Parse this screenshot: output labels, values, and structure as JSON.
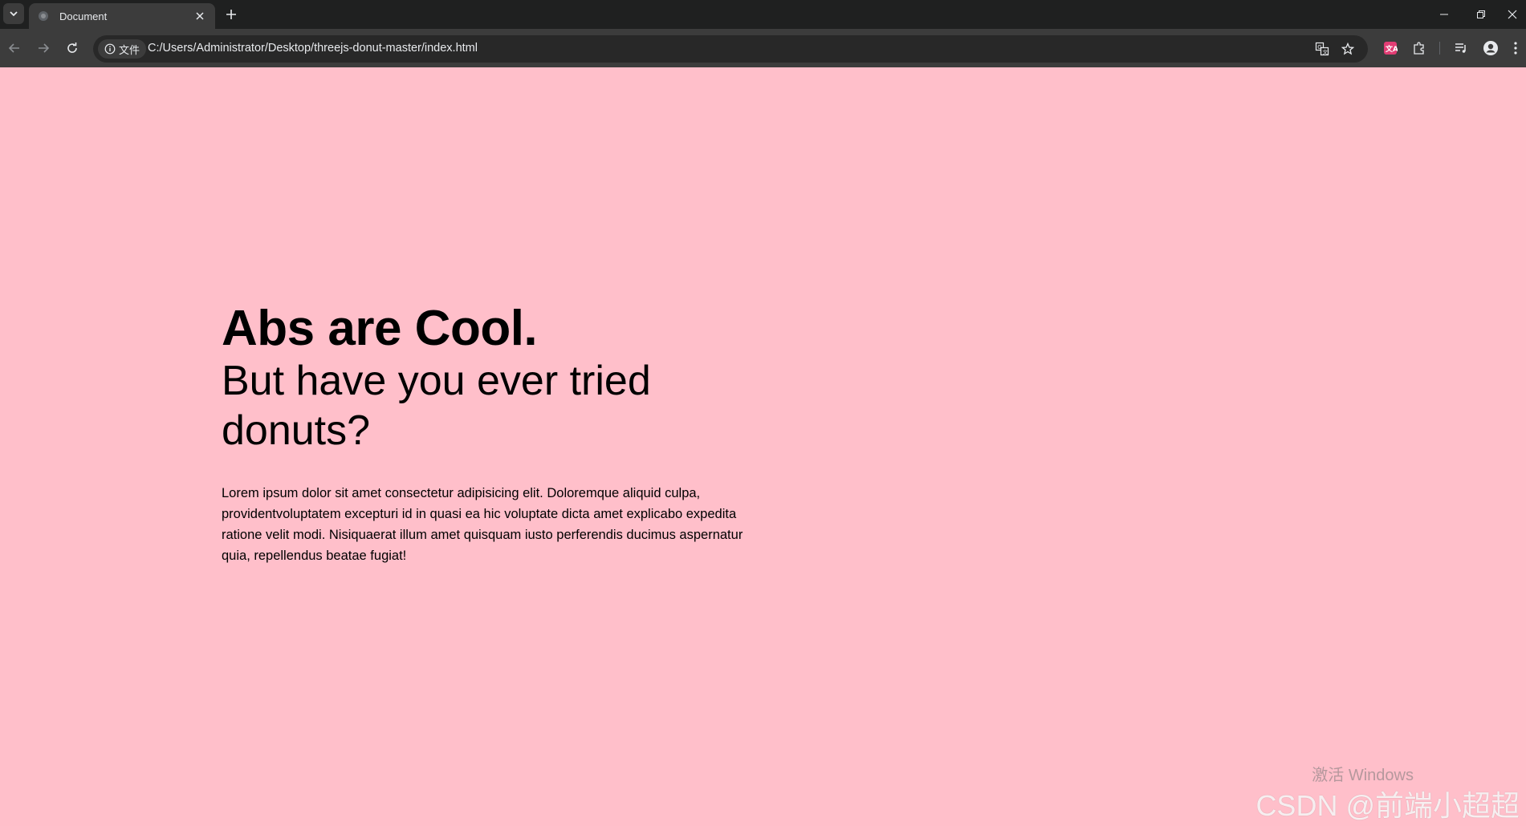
{
  "browser": {
    "tab": {
      "title": "Document"
    },
    "address_bar": {
      "site_info_label": "文件",
      "url": "C:/Users/Administrator/Desktop/threejs-donut-master/index.html"
    }
  },
  "page": {
    "background_color": "#ffbfca",
    "title": "Abs are Cool.",
    "subtitle": "But have you ever tried donuts?",
    "body": "Lorem ipsum dolor sit amet consectetur adipisicing elit. Doloremque aliquid culpa, providentvoluptatem excepturi id in quasi ea hic voluptate dicta amet explicabo expedita ratione velit modi. Nisiquaerat illum amet quisquam iusto perferendis ducimus aspernatur quia, repellendus beatae fugiat!"
  },
  "watermarks": {
    "windows": "激活 Windows",
    "csdn": "CSDN @前端小超超"
  },
  "icons": {
    "tab_list": "chevron-down-icon",
    "favicon": "globe-icon",
    "tab_close": "close-icon",
    "new_tab": "plus-icon",
    "back": "arrow-left-icon",
    "forward": "arrow-right-icon",
    "reload": "reload-icon",
    "site_info": "info-icon",
    "translate": "translate-icon",
    "bookmark": "star-icon",
    "extension_app": "extension-app-icon",
    "extensions": "puzzle-icon",
    "media": "media-icon",
    "profile": "profile-icon",
    "menu": "kebab-menu-icon",
    "minimize": "minimize-icon",
    "restore": "restore-icon",
    "close_window": "close-window-icon"
  }
}
